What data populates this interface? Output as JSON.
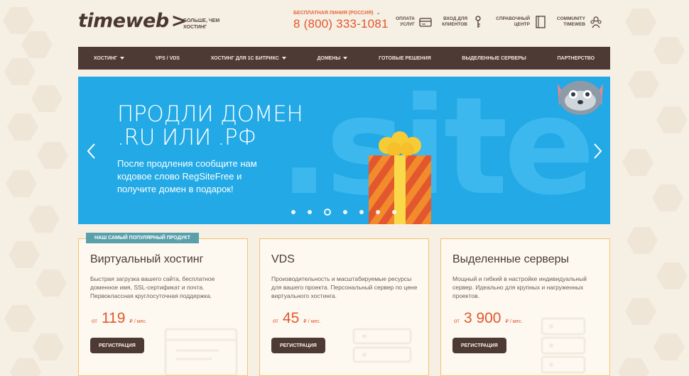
{
  "brand": {
    "logo": "timeweb",
    "slogan": "Больше, чем хостинг"
  },
  "hotline": {
    "label": "Бесплатная линия (Россия)",
    "phone": "8 (800) 333-1081"
  },
  "header_links": [
    {
      "label": "Оплата услуг",
      "icon": "wallet-icon"
    },
    {
      "label": "Вход для клиентов",
      "icon": "key-icon"
    },
    {
      "label": "Справочный центр",
      "icon": "book-icon"
    },
    {
      "label": "Community timeweb",
      "icon": "community-icon"
    }
  ],
  "nav": [
    {
      "label": "Хостинг",
      "dropdown": true
    },
    {
      "label": "VPS / VDS",
      "dropdown": false
    },
    {
      "label": "Хостинг для 1С Битрикс",
      "dropdown": true
    },
    {
      "label": "Домены",
      "dropdown": true
    },
    {
      "label": "Готовые решения",
      "dropdown": false
    },
    {
      "label": "Выделенные серверы",
      "dropdown": false
    },
    {
      "label": "Партнерство",
      "dropdown": false
    }
  ],
  "banner": {
    "title_line1": "ПРОДЛИ ДОМЕН",
    "title_line2": ".RU ИЛИ .РФ",
    "text": "После продления сообщите нам кодовое слово RegSiteFree и получите домен в подарок!",
    "bg_word": ".site",
    "slides_count": 7,
    "active_slide": 3
  },
  "cards": [
    {
      "badge": "Наш самый популярный продукт",
      "title": "Виртуальный хостинг",
      "desc": "Быстрая загрузка вашего сайта, бесплатное доменное имя, SSL-сертификат и почта. Первоклассная круглосуточная поддержка.",
      "from": "от",
      "price": "119",
      "unit": "₽ / мес.",
      "button": "Регистрация"
    },
    {
      "title": "VDS",
      "desc": "Производительность и масштабируемые ресурсы для вашего проекта. Персональный сервер по цене виртуального хостинга.",
      "from": "от",
      "price": "45",
      "unit": "₽ / мес.",
      "button": "Регистрация"
    },
    {
      "title": "Выделенные серверы",
      "desc": "Мощный и гибкий в настройке индивидуальный сервер. Идеально для крупных и нагруженных проектов.",
      "from": "от",
      "price": "3 900",
      "unit": "₽ / мес.",
      "button": "Регистрация"
    }
  ],
  "colors": {
    "brand_brown": "#4e3a34",
    "accent_orange": "#e2572e",
    "banner_blue": "#22a9e6",
    "card_border": "#f5c36a",
    "badge_teal": "#5aa0ab"
  }
}
